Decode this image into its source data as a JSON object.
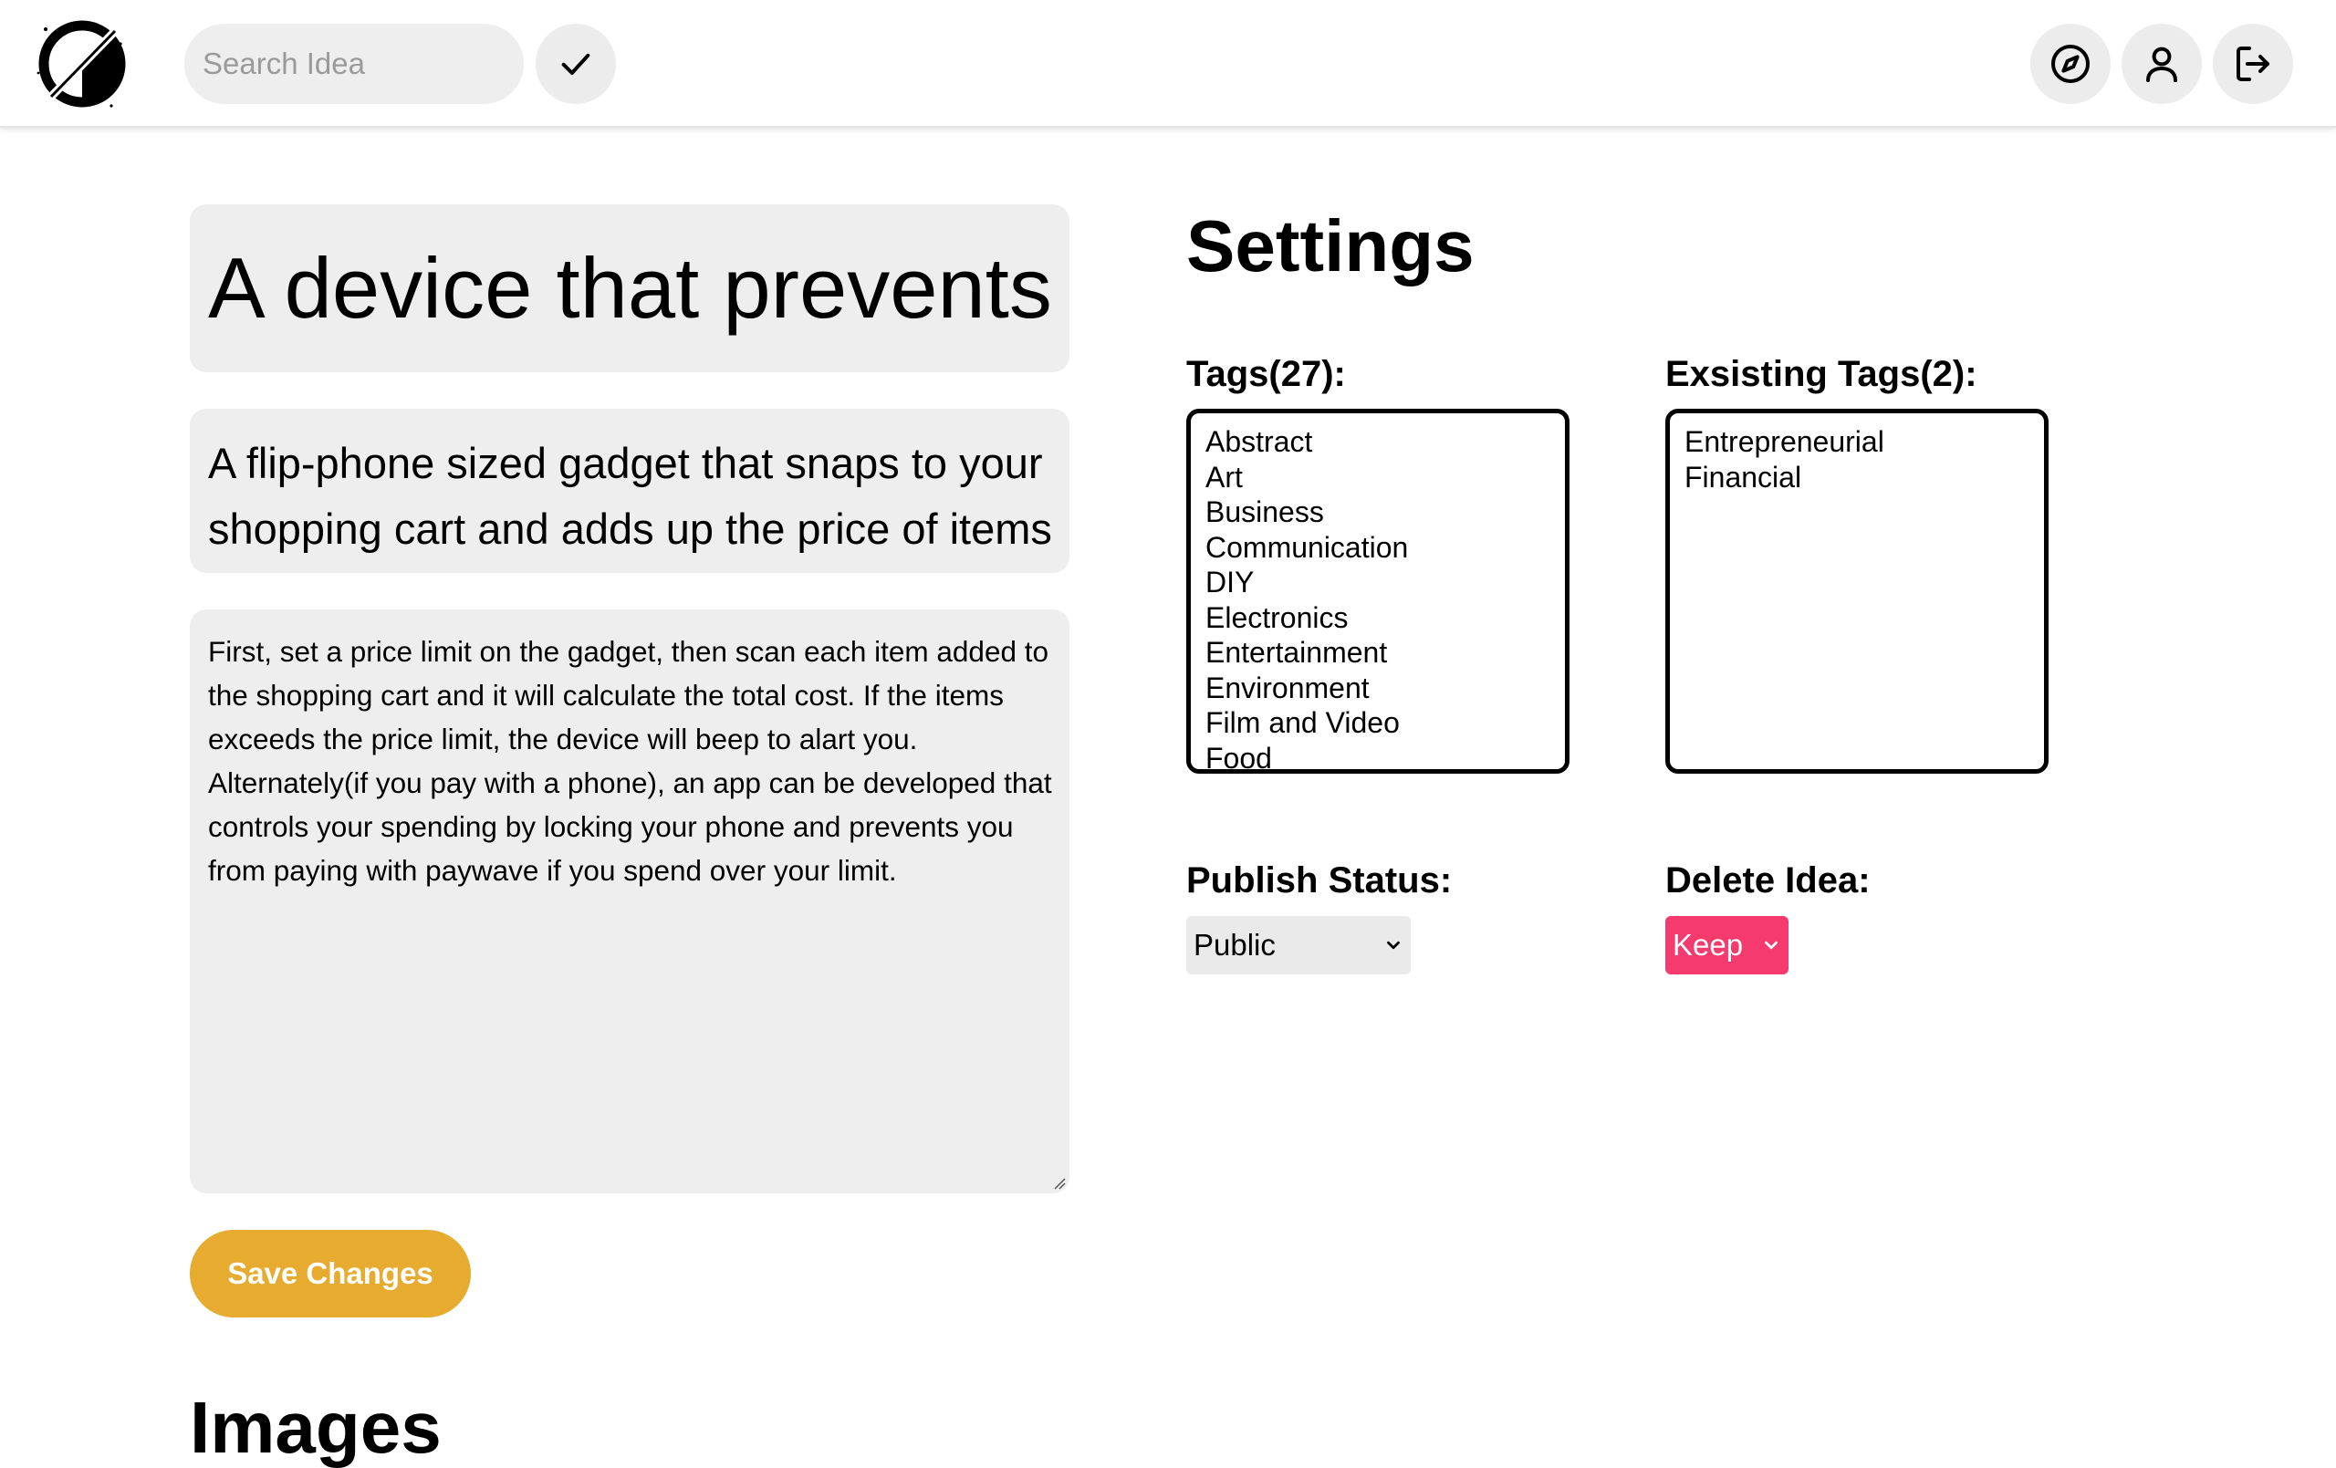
{
  "header": {
    "logo_icon": "slashed-circle-logo",
    "search_placeholder": "Search Idea",
    "confirm_icon": "check-icon",
    "nav_icons": [
      "compass-icon",
      "user-icon",
      "logout-icon"
    ]
  },
  "idea": {
    "title": "A device that prevents",
    "subtitle": "A flip-phone sized gadget that snaps to your shopping cart and adds up the price of items",
    "description": "First, set a price limit on the gadget, then scan each item added to the shopping cart and it will calculate the total cost. If the items exceeds the price limit, the device will beep to alart you. Alternately(if you pay with a phone), an app can be developed that controls your spending by locking your phone and prevents you from paying with paywave if you spend over your limit."
  },
  "actions": {
    "save_label": "Save Changes"
  },
  "settings": {
    "heading": "Settings",
    "tags_label": "Tags(27):",
    "tags": [
      "Abstract",
      "Art",
      "Business",
      "Communication",
      "DIY",
      "Electronics",
      "Entertainment",
      "Environment",
      "Film and Video",
      "Food"
    ],
    "existing_tags_label": "Exsisting Tags(2):",
    "existing_tags": [
      "Entrepreneurial",
      "Financial"
    ],
    "publish_label": "Publish Status:",
    "publish_value": "Public",
    "delete_label": "Delete Idea:",
    "delete_value": "Keep"
  },
  "images": {
    "heading": "Images"
  },
  "colors": {
    "accent_save": "#e6ab2f",
    "delete_select": "#f53b6e",
    "field_background": "#eeeeee"
  }
}
